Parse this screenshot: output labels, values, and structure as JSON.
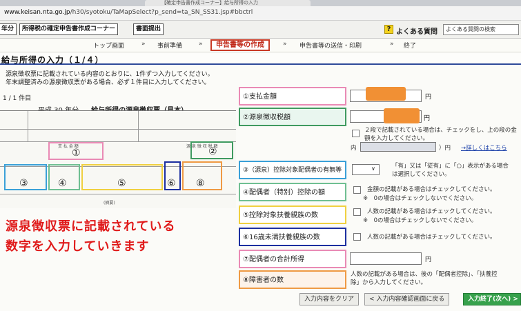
{
  "browser": {
    "tab_title": "【確定申告書作成コーナー】給与所得の入力",
    "url_host": "www.keisan.nta.go.jp",
    "url_path": "/h30/syotoku/TaMapSelect?p_send=ta_SN_SS31.jsp#bbctrl"
  },
  "topbar": {
    "year_btn": "年分",
    "corner_btn": "所得税の確定申告書作成コーナー",
    "print_btn": "書面提出",
    "faq_link": "よくある質問",
    "faq_search": "よくある質問の検索"
  },
  "steps": {
    "top": "トップ画面",
    "prep": "事前準備",
    "create": "申告書等の作成",
    "send": "申告書等の送信・印刷",
    "end": "終了"
  },
  "page_title": "給与所得の入力（１/４）",
  "instructions": {
    "line1": "源泉徴収票に記載されている内容のとおりに、1件ずつ入力してください。",
    "line2": "年末調整済みの源泉徴収票がある場合、必ず１件目に入力してください。",
    "count": "1 / 1 件目"
  },
  "slip": {
    "year": "平成 30 年分",
    "title": "給与所得の源泉徴収票（見本）",
    "labels": {
      "pay": "支 払 金 額",
      "tax": "源 泉 徴 収 税 額",
      "spouse": "(源泉)控除対象配偶者の有無等",
      "spouse_deduction": "配偶者(特別)控除の額",
      "dependents": "控除対象扶養親族の数",
      "under16": "16歳未満扶養親族の数",
      "disabled": "障害者の数",
      "remarks": "(摘要)"
    },
    "numbers": [
      "①",
      "②",
      "③",
      "④",
      "⑤",
      "⑥",
      "⑧"
    ]
  },
  "overlay": {
    "line1": "源泉徴収票に記載されている",
    "line2": "数字を入力していきます"
  },
  "form": {
    "fields": [
      {
        "label": "①支払金額"
      },
      {
        "label": "②源泉徴収税額"
      },
      {
        "label": "③（源泉）控除対象配偶者の有無等"
      },
      {
        "label": "④配偶者（特別）控除の額"
      },
      {
        "label": "⑤控除対象扶養親族の数"
      },
      {
        "label": "⑥16歳未満扶養親族の数"
      },
      {
        "label": "⑦配偶者の合計所得"
      },
      {
        "label": "⑧障害者の数"
      }
    ],
    "unit_yen": "円",
    "tax_note_line1": "２段で記載されている場合は、チェックをし、上の段の金",
    "tax_note_line2": "額を入力してください。",
    "inner_prefix": "内（",
    "inner_suffix": "）円",
    "detail_link": "→詳しくはこちら",
    "spouse_note_line1": "「有」又は「従有」に「○」表示がある場合",
    "spouse_note_line2": "は選択してください。",
    "deduction_check_note": "金額の記載がある場合はチェックしてください。",
    "deduction_sub_note": "※　0の場合はチェックしないでください。",
    "dependents_check_note": "人数の記載がある場合はチェックしてください。",
    "dependents_sub_note": "※　0の場合はチェックしないでください。",
    "under16_check_note": "人数の記載がある場合はチェックしてください。",
    "disabled_note_line1": "人数の記載がある場合は、後の「配偶者控除」、「扶養控",
    "disabled_note_line2": "除」から入力してください。"
  },
  "buttons": {
    "clear": "入力内容をクリア",
    "back": "< 入力内容確認画面に戻る",
    "finish": "入力終了(次へ) >"
  },
  "colors": {
    "accent_red": "#c93a26",
    "nav_blue": "#2e4a99",
    "finish_green": "#37a14c",
    "mask_orange": "#f19034"
  }
}
